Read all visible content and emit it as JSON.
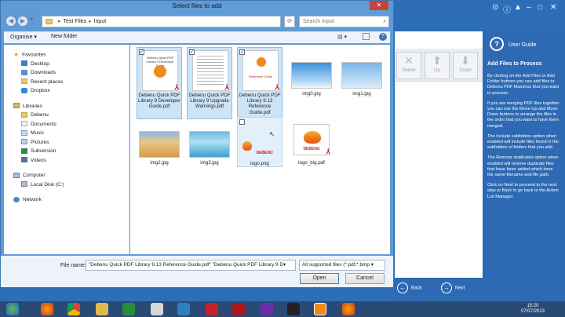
{
  "dialog": {
    "title": "Select files to add",
    "close_glyph": "✕",
    "address": {
      "segments": [
        "Test Files",
        "Input"
      ]
    },
    "search_placeholder": "Search Input",
    "toolbar": {
      "organise": "Organise ▾",
      "new_folder": "New folder"
    },
    "nav": {
      "favourites": "Favourites",
      "fav_items": [
        "Desktop",
        "Downloads",
        "Recent places",
        "Dropbox"
      ],
      "libraries": "Libraries",
      "lib_items": [
        "Debenu",
        "Documents",
        "Music",
        "Pictures",
        "Subversion",
        "Videos"
      ],
      "computer": "Computer",
      "comp_items": [
        "Local Disk (C:)"
      ],
      "network": "Network"
    },
    "files": [
      {
        "name": "Debenu Quick PDF Library 9 Developer Guide.pdf",
        "kind": "pdf",
        "selected": true
      },
      {
        "name": "Debenu Quick PDF Library 9 Upgrade Warnings.pdf",
        "kind": "pdf",
        "selected": true
      },
      {
        "name": "Debenu Quick PDF Library 9.13 Reference Guide.pdf",
        "kind": "pdf",
        "selected": true
      },
      {
        "name": "img0.jpg",
        "kind": "image"
      },
      {
        "name": "img1.jpg",
        "kind": "image"
      },
      {
        "name": "img2.jpg",
        "kind": "image"
      },
      {
        "name": "img3.jpg",
        "kind": "image"
      },
      {
        "name": "logo.png",
        "kind": "image",
        "hover": true
      },
      {
        "name": "logo_big.pdf",
        "kind": "pdf"
      }
    ],
    "cover_text": {
      "dev_guide": "Debenu Quick PDF Library 9 Developer Guide",
      "ref_guide": "Reference Guide",
      "logo": "DEBENU"
    },
    "bottom": {
      "filename_label": "File name:",
      "filename_value": "\"Debenu Quick PDF Library 9.13 Reference Guide.pdf\" \"Debenu Quick PDF Library 9 D▾",
      "filter_value": "All supported files (*.pdf;*.bmp ▾",
      "open": "Open",
      "cancel": "Cancel"
    }
  },
  "background_app": {
    "tools": [
      "Delete",
      "Up",
      "Down"
    ],
    "user_guide": "User Guide",
    "guide_title": "Add Files to Process",
    "guide_paragraphs": [
      "By clicking on the Add Files or Add Folder buttons you can add files to Debenu PDF Maximus that you want to process.",
      "If you are merging PDF files together you can use the Move Up and Move Down buttons to arrange the files in the order that you want to have them merged.",
      "The Include subfolders option when enabled will include files found in the subfolders of folders that you add.",
      "The Remove duplicates option when enabled will remove duplicate files that have been added which have the same filename and file path.",
      "Click on Next to proceed to the next step or Back to go back to the Action List Manager."
    ],
    "back": "Back",
    "next": "Next"
  },
  "taskbar": {
    "time": "15:20",
    "date": "07/07/2013"
  },
  "colors": {
    "accent": "#2e6eb8",
    "selection": "#cce4f7",
    "close": "#c7443a"
  }
}
